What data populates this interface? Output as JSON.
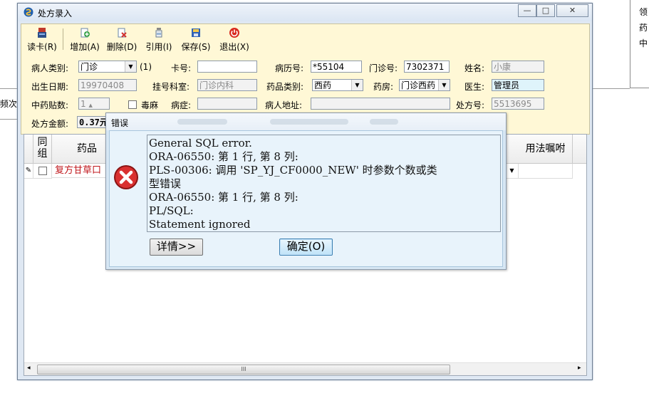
{
  "background": {
    "right_chars": [
      "领",
      "药",
      "中"
    ],
    "left_chars": [
      "频次"
    ]
  },
  "window": {
    "title": "处方录入",
    "controls": {
      "minimize": "—",
      "maximize": "□",
      "close": "✕"
    }
  },
  "toolbar": {
    "read_card": "读卡(R)",
    "add": "增加(A)",
    "delete": "删除(D)",
    "quote": "引用(I)",
    "save": "保存(S)",
    "exit": "退出(X)"
  },
  "form": {
    "patient_type_label": "病人类别:",
    "patient_type_value": "门诊",
    "patient_type_suffix": "(1)",
    "card_no_label": "卡号:",
    "card_no_value": "",
    "record_no_label": "病历号:",
    "record_no_value": "*55104",
    "clinic_no_label": "门诊号:",
    "clinic_no_value": "7302371",
    "name_label": "姓名:",
    "name_value": "小康",
    "birth_label": "出生日期:",
    "birth_value": "19970408",
    "dept_label": "挂号科室:",
    "dept_value": "门诊内科",
    "drug_type_label": "药品类别:",
    "drug_type_value": "西药",
    "pharmacy_label": "药房:",
    "pharmacy_value": "门诊西药",
    "doctor_label": "医生:",
    "doctor_value": "管理员",
    "doses_label": "中药贴数:",
    "doses_value": "1",
    "narcotic_label": "毒麻",
    "disease_label": "病症:",
    "disease_value": "",
    "address_label": "病人地址:",
    "address_value": "",
    "rx_no_label": "处方号:",
    "rx_no_value": "5513695",
    "amount_label": "处方金额:",
    "amount_value": "0.37元"
  },
  "grid": {
    "headers": {
      "group": "同组",
      "drug": "药品",
      "usage": "用法嘱咐"
    },
    "row1_drug": "复方甘草口"
  },
  "scrollbar": {
    "grip": "III"
  },
  "dialog": {
    "title": "错误",
    "message_lines": [
      "General SQL error.",
      "ORA-06550: 第 1 行, 第 8 列:",
      "PLS-00306: 调用 'SP_YJ_CF0000_NEW' 时参数个数或类",
      "型错误",
      "ORA-06550: 第 1 行, 第 8 列:",
      "PL/SQL:",
      "Statement ignored"
    ],
    "details_button": "详情>>",
    "ok_button": "确定(O)"
  }
}
